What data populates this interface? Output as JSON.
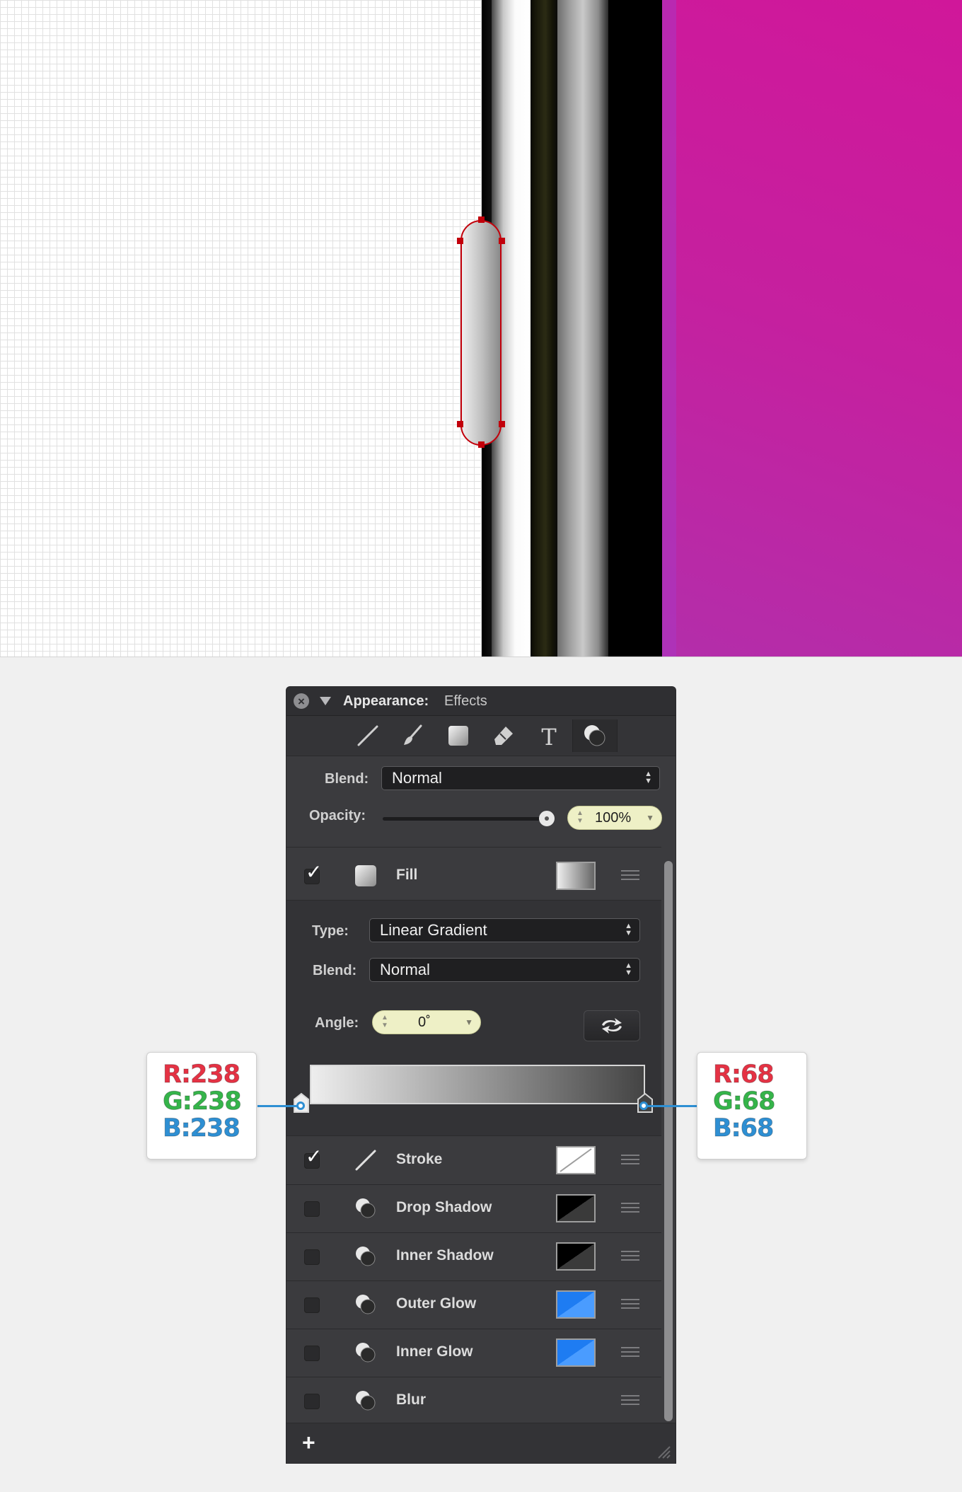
{
  "panel": {
    "title": "Appearance:",
    "subtitle": "Effects",
    "close_icon": "close-icon",
    "tools": [
      "line-tool-icon",
      "brush-tool-icon",
      "fill-tool-icon",
      "eraser-tool-icon",
      "text-tool-icon",
      "effects-tool-icon"
    ],
    "blend_label": "Blend:",
    "blend_value": "Normal",
    "opacity_label": "Opacity:",
    "opacity_value": "100%",
    "opacity_level": 1.0,
    "fill_row": {
      "checked": true,
      "label": "Fill",
      "swatch": "gradient-swatch"
    },
    "fill_detail": {
      "type_label": "Type:",
      "type_value": "Linear Gradient",
      "blend_label": "Blend:",
      "blend_value": "Normal",
      "angle_label": "Angle:",
      "angle_value": "0˚",
      "gradient_stops": [
        "#eeeeee",
        "#444444"
      ]
    },
    "effects": [
      {
        "label": "Stroke",
        "checked": true,
        "swatch_color": "#ffffff"
      },
      {
        "label": "Drop Shadow",
        "checked": false,
        "swatch_color": "#000000"
      },
      {
        "label": "Inner Shadow",
        "checked": false,
        "swatch_color": "#000000"
      },
      {
        "label": "Outer Glow",
        "checked": false,
        "swatch_color": "#1e7cf2"
      },
      {
        "label": "Inner Glow",
        "checked": false,
        "swatch_color": "#1e7cf2"
      },
      {
        "label": "Blur",
        "checked": false,
        "swatch_color": ""
      }
    ],
    "add_label": "+"
  },
  "callouts": {
    "left": {
      "r": "R:238",
      "g": "G:238",
      "b": "B:238"
    },
    "right": {
      "r": "R:68",
      "g": "G:68",
      "b": "B:68"
    }
  },
  "colors": {
    "magenta": "#cc1a9d",
    "selection": "#c2000b",
    "accent_blue": "#2e8fd3"
  }
}
